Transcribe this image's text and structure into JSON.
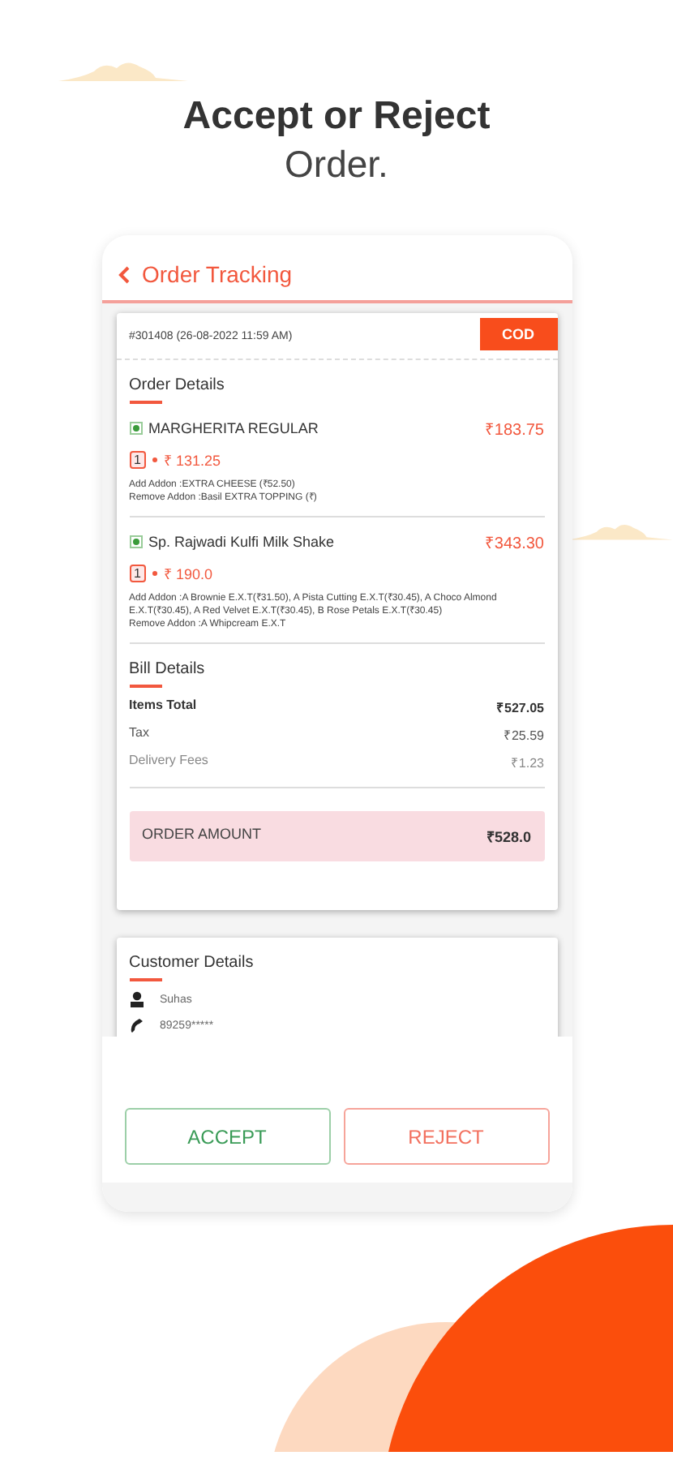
{
  "headline": {
    "title": "Accept or Reject",
    "subtitle": "Order."
  },
  "header": {
    "title": "Order Tracking"
  },
  "order": {
    "number": "#301408 (26-08-2022 11:59 AM)",
    "payment": "COD"
  },
  "order_details": {
    "heading": "Order Details",
    "items": [
      {
        "name": "MARGHERITA REGULAR",
        "price": "₹183.75",
        "quantity": "1",
        "unit_price": "₹ 131.25",
        "addons": [
          "Add Addon :EXTRA CHEESE (₹52.50)",
          "Remove Addon :Basil EXTRA TOPPING (₹)"
        ]
      },
      {
        "name": "Sp. Rajwadi Kulfi Milk Shake",
        "price": "₹343.30",
        "quantity": "1",
        "unit_price": "₹ 190.0",
        "addons": [
          "Add Addon :A Brownie E.X.T(₹31.50), A Pista Cutting E.X.T(₹30.45), A Choco Almond E.X.T(₹30.45), A Red Velvet E.X.T(₹30.45), B Rose Petals E.X.T(₹30.45)",
          "Remove Addon :A Whipcream E.X.T"
        ]
      }
    ]
  },
  "bill_details": {
    "heading": "Bill Details",
    "rows": [
      {
        "kind": "strong",
        "label": "Items Total",
        "value": "₹527.05"
      },
      {
        "kind": "normal",
        "label": "Tax",
        "value": "₹25.59"
      },
      {
        "kind": "muted",
        "label": "Delivery Fees",
        "value": "₹1.23"
      }
    ],
    "total": {
      "label": "ORDER AMOUNT",
      "value": "₹528.0"
    }
  },
  "customer_details": {
    "heading": "Customer Details",
    "name": "Suhas",
    "phone": "89259*****"
  },
  "buttons": [
    {
      "kind": "accept",
      "label": "ACCEPT"
    },
    {
      "kind": "reject",
      "label": "REJECT"
    }
  ]
}
